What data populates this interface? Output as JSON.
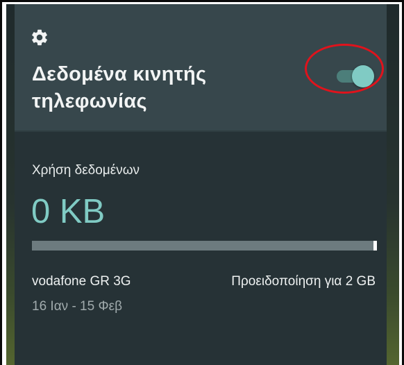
{
  "quick_settings": {
    "settings_icon": "gear-icon",
    "title": "Δεδομένα κινητής τηλεφωνίας",
    "toggle": {
      "state": "on",
      "accent_color": "#80cbc4"
    },
    "annotation_color": "#e0131c"
  },
  "usage": {
    "label": "Χρήση δεδομένων",
    "value": "0 KB",
    "progress_fraction": 0.0,
    "carrier": "vodafone GR 3G",
    "period": "16 Ιαν - 15 Φεβ",
    "warning": "Προειδοποίηση για 2 GB"
  }
}
